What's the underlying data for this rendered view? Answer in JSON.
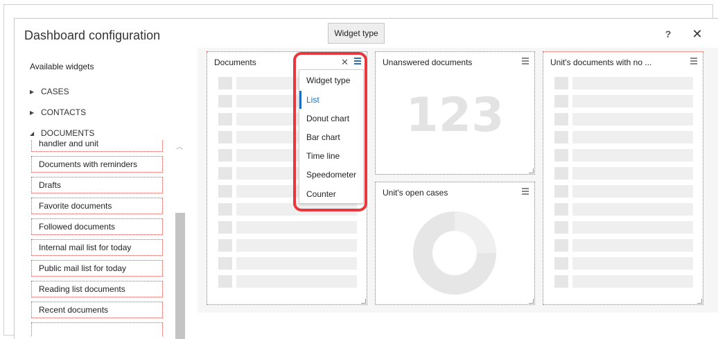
{
  "dialog": {
    "title": "Dashboard configuration",
    "widget_type_tooltip": "Widget type",
    "help_label": "?",
    "close_label": "✕"
  },
  "sidebar": {
    "available_label": "Available widgets",
    "categories": [
      {
        "label": "CASES",
        "expanded": false
      },
      {
        "label": "CONTACTS",
        "expanded": false
      },
      {
        "label": "DOCUMENTS",
        "expanded": true
      }
    ],
    "items": [
      {
        "label": "handler and unit"
      },
      {
        "label": "Documents with reminders"
      },
      {
        "label": "Drafts"
      },
      {
        "label": "Favorite documents"
      },
      {
        "label": "Followed documents"
      },
      {
        "label": "Internal mail list for today"
      },
      {
        "label": "Public mail list for today"
      },
      {
        "label": "Reading list documents"
      },
      {
        "label": "Recent documents"
      }
    ]
  },
  "panels": {
    "documents": {
      "title": "Documents"
    },
    "unanswered": {
      "title": "Unanswered documents",
      "count": "123"
    },
    "open_cases": {
      "title": "Unit's open cases"
    },
    "no_handler": {
      "title": "Unit's documents with no ..."
    }
  },
  "dropdown": {
    "close_label": "✕",
    "header": "Widget type",
    "options": [
      {
        "label": "List",
        "selected": true
      },
      {
        "label": "Donut chart",
        "selected": false
      },
      {
        "label": "Bar chart",
        "selected": false
      },
      {
        "label": "Time line",
        "selected": false
      },
      {
        "label": "Speedometer",
        "selected": false
      },
      {
        "label": "Counter",
        "selected": false
      }
    ]
  },
  "colors": {
    "accent": "#1b6ec2",
    "highlight": "#e8383d",
    "panel_border": "#d9534f",
    "placeholder": "#e6e6e6"
  }
}
